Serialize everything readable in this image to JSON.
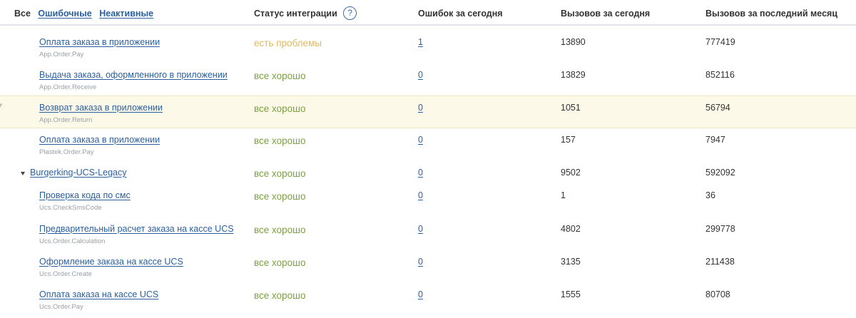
{
  "header": {
    "filter_all": "Все",
    "filter_errors": "Ошибочные",
    "filter_inactive": "Неактивные",
    "status_label": "Статус интеграции",
    "help_icon": "?",
    "errors_today": "Ошибок за сегодня",
    "calls_today": "Вызовов за сегодня",
    "calls_month": "Вызовов за последний месяц"
  },
  "rows": [
    {
      "name": "Оплата заказа в приложении",
      "code": "App.Order.Pay",
      "status": "есть проблемы",
      "errors": "1",
      "calls": "13890",
      "month": "777419"
    },
    {
      "name": "Выдача заказа, оформленного в приложении",
      "code": "App.Order.Receive",
      "status": "все хорошо",
      "errors": "0",
      "calls": "13829",
      "month": "852116"
    },
    {
      "name": "Возврат заказа в приложении",
      "code": "App.Order.Return",
      "status": "все хорошо",
      "errors": "0",
      "calls": "1051",
      "month": "56794"
    },
    {
      "name": "Оплата заказа в приложении",
      "code": "Plastek.Order.Pay",
      "status": "все хорошо",
      "errors": "0",
      "calls": "157",
      "month": "7947"
    },
    {
      "name": "Burgerking-UCS-Legacy",
      "status": "все хорошо",
      "errors": "0",
      "calls": "9502",
      "month": "592092"
    },
    {
      "name": "Проверка кода по смс",
      "code": "Ucs.CheckSmsCode",
      "status": "все хорошо",
      "errors": "0",
      "calls": "1",
      "month": "36"
    },
    {
      "name": "Предварительный расчет заказа на кассе UCS",
      "code": "Ucs.Order.Calculation",
      "status": "все хорошо",
      "errors": "0",
      "calls": "4802",
      "month": "299778"
    },
    {
      "name": "Оформление заказа на кассе UCS",
      "code": "Ucs.Order.Create",
      "status": "все хорошо",
      "errors": "0",
      "calls": "3135",
      "month": "211438"
    },
    {
      "name": "Оплата заказа на кассе UCS",
      "code": "Ucs.Order.Pay",
      "status": "все хорошо",
      "errors": "0",
      "calls": "1555",
      "month": "80708"
    }
  ],
  "icons": {
    "drag_handle": "drag-handle-icon",
    "group_toggle": "caret-down-icon"
  },
  "colors": {
    "link": "#2a5f9e",
    "status_ok": "#7ba23f",
    "status_warn": "#e2b85a",
    "highlight_row": "#fcf9e8"
  }
}
